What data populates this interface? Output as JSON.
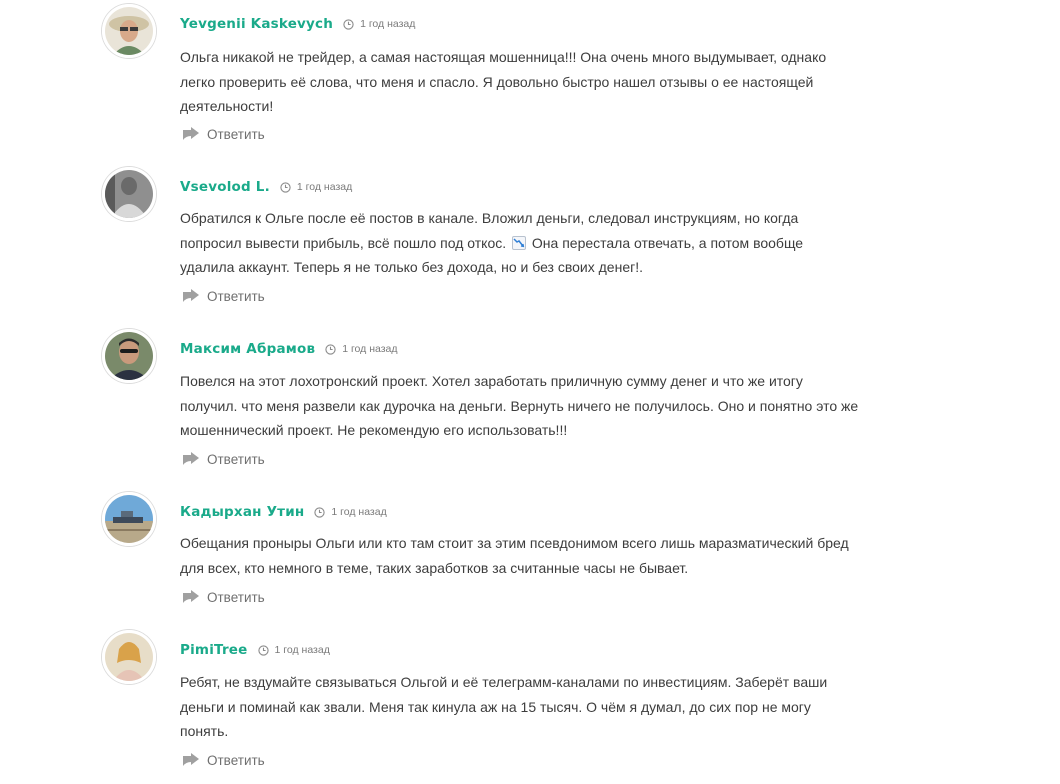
{
  "comments": [
    {
      "author": "Yevgenii Kaskevych",
      "time": "1 год назад",
      "text": "Ольга никакой не трейдер, а самая настоящая мошенница!!! Она очень много выдумывает, однако легко проверить её слова, что меня и спасло. Я довольно быстро нашел отзывы о ее настоящей деятельности!",
      "reply": "Ответить"
    },
    {
      "author": "Vsevolod L.",
      "time": "1 год назад",
      "text_before": "Обратился к Ольге после её постов в канале. Вложил деньги, следовал инструкциям, но когда попросил вывести прибыль, всё пошло под откос. ",
      "text_after": " Она перестала отвечать, а потом вообще удалила аккаунт. Теперь я не только без дохода, но и без своих денег!.",
      "reply": "Ответить"
    },
    {
      "author": "Максим Абрамов",
      "time": "1 год назад",
      "text": "Повелся на этот лохотронский проект. Хотел заработать приличную сумму денег и что же итогу получил. что меня развели как дурочка на деньги. Вернуть ничего не получилось. Оно и понятно это же мошеннический проект. Не рекомендую его использовать!!!",
      "reply": "Ответить"
    },
    {
      "author": "Кадырхан Утин",
      "time": "1 год назад",
      "text": "Обещания проныры Ольги или кто там стоит за этим псевдонимом всего лишь маразматический бред для всех, кто немного в теме, таких заработков за считанные часы не бывает.",
      "reply": "Ответить"
    },
    {
      "author": "PimiTree",
      "time": "1 год назад",
      "text": "Ребят, не вздумайте связываться Ольгой и её телеграмм-каналами по инвестициям. Заберёт ваши деньги и поминай как звали. Меня так кинула аж на 15 тысяч. О чём я думал, до сих пор не могу понять.",
      "reply": "Ответить"
    }
  ],
  "colors": {
    "author": "#1aaa8a",
    "text": "#3d3d3d",
    "meta": "#7a7a7a",
    "reply_icon": "#9a9a9a"
  },
  "icons": {
    "time": "clock-icon",
    "reply": "reply-arrow-icon",
    "inline_emoji": "chart-decreasing-icon"
  }
}
